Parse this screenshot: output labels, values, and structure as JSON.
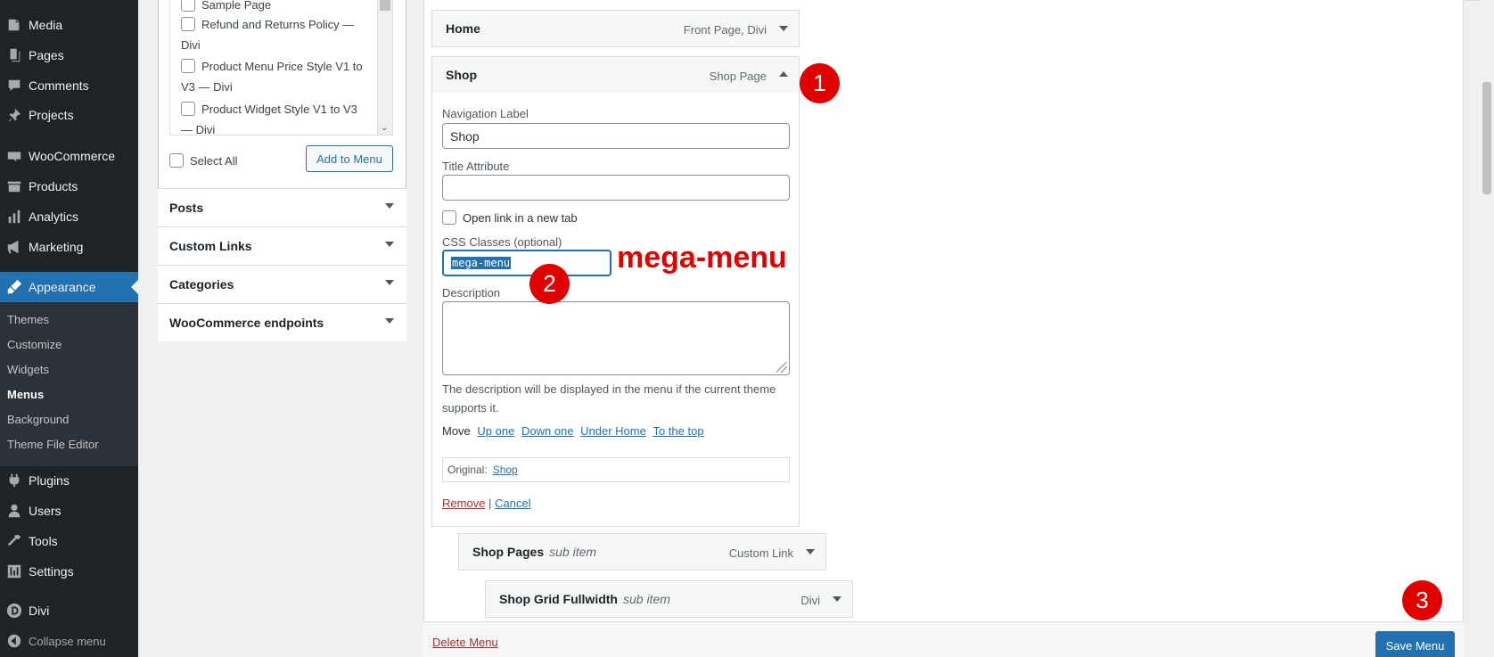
{
  "sidebar": {
    "items": [
      {
        "label": "Media",
        "icon": "media-icon"
      },
      {
        "label": "Pages",
        "icon": "pages-icon"
      },
      {
        "label": "Comments",
        "icon": "comments-icon"
      },
      {
        "label": "Projects",
        "icon": "projects-icon"
      },
      {
        "label": "WooCommerce",
        "icon": "woocommerce-icon"
      },
      {
        "label": "Products",
        "icon": "products-icon"
      },
      {
        "label": "Analytics",
        "icon": "analytics-icon"
      },
      {
        "label": "Marketing",
        "icon": "marketing-icon"
      },
      {
        "label": "Appearance",
        "icon": "appearance-icon"
      },
      {
        "label": "Plugins",
        "icon": "plugins-icon"
      },
      {
        "label": "Users",
        "icon": "users-icon"
      },
      {
        "label": "Tools",
        "icon": "tools-icon"
      },
      {
        "label": "Settings",
        "icon": "settings-icon"
      },
      {
        "label": "Divi",
        "icon": "divi-icon"
      },
      {
        "label": "Collapse menu",
        "icon": "collapse-icon"
      }
    ],
    "submenu": [
      "Themes",
      "Customize",
      "Widgets",
      "Menus",
      "Background",
      "Theme File Editor"
    ],
    "accent_color": "#2271b1"
  },
  "add_items": {
    "pages": [
      {
        "line1": "Sample Page",
        "line2": ""
      },
      {
        "line1": "Refund and Returns Policy —",
        "line2": "Divi"
      },
      {
        "line1": "Product Menu Price Style V1 to",
        "line2": "V3 — Divi"
      },
      {
        "line1": "Product Widget Style V1 to V3",
        "line2": "— Divi"
      }
    ],
    "select_all": "Select All",
    "add_to_menu": "Add to Menu",
    "sections": [
      "Posts",
      "Custom Links",
      "Categories",
      "WooCommerce endpoints"
    ]
  },
  "menu_structure": {
    "home": {
      "title": "Home",
      "type": "Front Page, Divi"
    },
    "shop": {
      "title": "Shop",
      "type": "Shop Page"
    },
    "settings": {
      "nav_label_title": "Navigation Label",
      "nav_label_value": "Shop",
      "title_attr_title": "Title Attribute",
      "title_attr_value": "",
      "new_tab": "Open link in a new tab",
      "css_title": "CSS Classes (optional)",
      "css_value": "mega-menu",
      "description_title": "Description",
      "description_note": "The description will be displayed in the menu if the current theme supports it.",
      "move_label": "Move",
      "move_links": [
        "Up one",
        "Down one",
        "Under Home",
        "To the top"
      ],
      "original_label": "Original:",
      "original_link": "Shop",
      "remove": "Remove",
      "separator": "|",
      "cancel": "Cancel"
    },
    "sub_items": [
      {
        "title": "Shop Pages",
        "sub": "sub item",
        "type": "Custom Link"
      },
      {
        "title": "Shop Grid Fullwidth",
        "sub": "sub item",
        "type": "Divi"
      }
    ],
    "delete_menu": "Delete Menu",
    "save_menu": "Save Menu"
  },
  "annotations": {
    "step1": "1",
    "step2": "2",
    "step3": "3",
    "callout": "mega-menu",
    "color": "#e00000"
  }
}
